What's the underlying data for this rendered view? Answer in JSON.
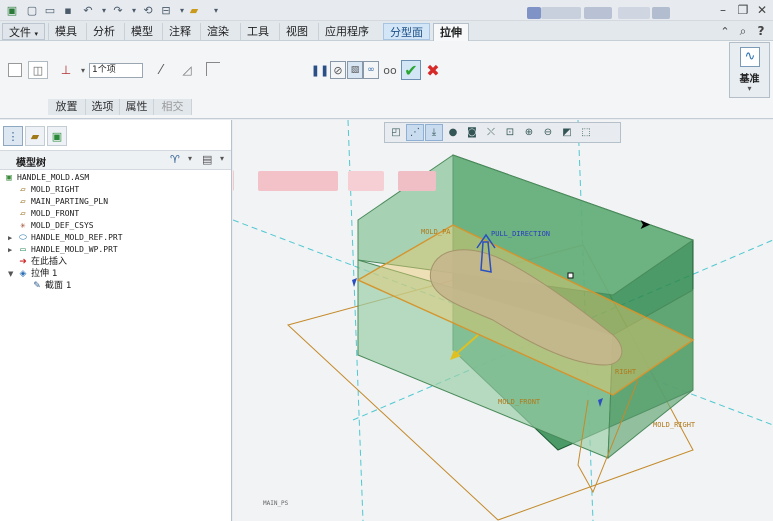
{
  "menu": {
    "file_label": "文件",
    "tabs": [
      "模具",
      "分析",
      "模型",
      "注释",
      "渲染",
      "工具",
      "视图",
      "应用程序"
    ],
    "context_tab": "分型面",
    "active_tab": "拉伸"
  },
  "ribbon": {
    "depth_value": "1个项",
    "group_labels": [
      "放置",
      "选项",
      "属性",
      "相交"
    ],
    "datum_label": "基准"
  },
  "model_tree": {
    "header": "模型树",
    "items": [
      {
        "label": "HANDLE_MOLD.ASM"
      },
      {
        "label": "MOLD_RIGHT"
      },
      {
        "label": "MAIN_PARTING_PLN"
      },
      {
        "label": "MOLD_FRONT"
      },
      {
        "label": "MOLD_DEF_CSYS"
      },
      {
        "label": "HANDLE_MOLD_REF.PRT"
      },
      {
        "label": "HANDLE_MOLD_WP.PRT"
      },
      {
        "label": "在此插入"
      },
      {
        "label": "拉伸 1"
      },
      {
        "label": "截面 1"
      }
    ]
  },
  "viewport": {
    "labels": {
      "pull_direction": "PULL_DIRECTION",
      "mold_parting": "MOLD_PA",
      "right": "RIGHT",
      "mold_front": "MOLD_FRONT",
      "mold_right": "MOLD_RIGHT",
      "status": "MAIN_PS"
    }
  },
  "colors": {
    "accent": "#2a6fb5",
    "confirm": "#2aa632",
    "cancel": "#d62a2a",
    "mold_green": "#2e8a4e",
    "parting_orange": "#d4952f",
    "ribbon_bg": "#f3f5f7",
    "context_tab_bg": "#d3e6f7"
  }
}
